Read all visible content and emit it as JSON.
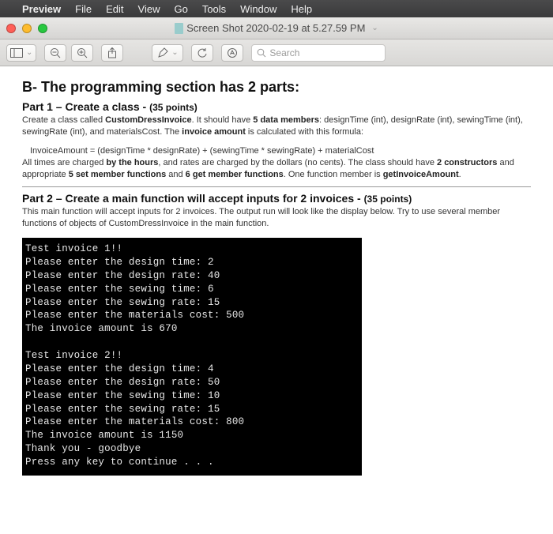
{
  "menubar": {
    "apple": "",
    "app": "Preview",
    "items": [
      "File",
      "Edit",
      "View",
      "Go",
      "Tools",
      "Window",
      "Help"
    ]
  },
  "window": {
    "title": "Screen Shot 2020-02-19 at 5.27.59 PM"
  },
  "toolbar": {
    "search_placeholder": "Search"
  },
  "document": {
    "heading": "B- The programming section has 2 parts:",
    "part1": {
      "title": "Part 1 – Create a class -",
      "points": "(35 points)",
      "para1_a": "Create a class called ",
      "para1_class": "CustomDressInvoice",
      "para1_b": ". It should have ",
      "para1_bold1": "5 data members",
      "para1_c": ": designTime (int), designRate (int), sewingTime (int), sewingRate (int), and materialsCost. The ",
      "para1_bold2": "invoice amount",
      "para1_d": " is calculated with this formula:",
      "formula": "InvoiceAmount = (designTime * designRate) + (sewingTime * sewingRate) + materialCost",
      "para2_a": "All times are charged ",
      "para2_bold1": "by the hours",
      "para2_b": ", and rates are charged by the dollars (no cents). The class should have ",
      "para2_bold2": "2 constructors",
      "para2_c": " and appropriate ",
      "para2_bold3": "5 set member functions",
      "para2_d": " and ",
      "para2_bold4": "6 get member functions",
      "para2_e": ". One function member is ",
      "para2_bold5": "getInvoiceAmount",
      "para2_f": "."
    },
    "part2": {
      "title": "Part 2 – Create a main function will accept inputs for 2 invoices -",
      "points": "(35 points)",
      "para": "This main function will accept inputs for 2 invoices. The output run will look like the display below. Try to use several member functions of objects of CustomDressInvoice in the main function."
    },
    "console_text": "Test invoice 1!!\nPlease enter the design time: 2\nPlease enter the design rate: 40\nPlease enter the sewing time: 6\nPlease enter the sewing rate: 15\nPlease enter the materials cost: 500\nThe invoice amount is 670\n\nTest invoice 2!!\nPlease enter the design time: 4\nPlease enter the design rate: 50\nPlease enter the sewing time: 10\nPlease enter the sewing rate: 15\nPlease enter the materials cost: 800\nThe invoice amount is 1150\nThank you - goodbye\nPress any key to continue . . ."
  }
}
